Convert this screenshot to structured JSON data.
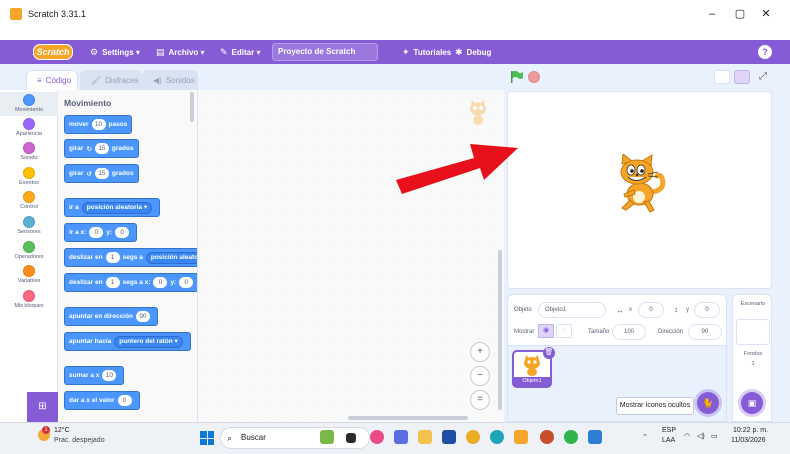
{
  "window": {
    "title": "Scratch 3.31.1",
    "minimize": "–",
    "maximize": "▢",
    "close": "✕"
  },
  "menubar": {
    "logo": "Scratch",
    "settings": "Settings",
    "file": "Archivo",
    "edit": "Editar",
    "project_title": "Proyecto de Scratch",
    "tutorials": "Tutoriales",
    "debug": "Debug",
    "help": "?"
  },
  "tabs": {
    "code": "Código",
    "costumes": "Disfraces",
    "sounds": "Sonidos"
  },
  "categories": [
    {
      "label": "Movimiento",
      "color": "#4c97ff"
    },
    {
      "label": "Apariencia",
      "color": "#9966ff"
    },
    {
      "label": "Sonido",
      "color": "#cf63cf"
    },
    {
      "label": "Eventos",
      "color": "#ffbf00"
    },
    {
      "label": "Control",
      "color": "#ffab19"
    },
    {
      "label": "Sensores",
      "color": "#5cb1d6"
    },
    {
      "label": "Operadores",
      "color": "#59c059"
    },
    {
      "label": "Variables",
      "color": "#ff8c1a"
    },
    {
      "label": "Mis bloques",
      "color": "#ff6680"
    }
  ],
  "palette": {
    "title": "Movimiento",
    "blocks": {
      "move": {
        "text": "mover",
        "value": "10",
        "suffix": "pasos"
      },
      "turn_right": {
        "text": "girar",
        "icon": "↻",
        "value": "15",
        "suffix": "grados"
      },
      "turn_left": {
        "text": "girar",
        "icon": "↺",
        "value": "15",
        "suffix": "grados"
      },
      "goto": {
        "text": "ir a",
        "dropdown": "posición aleatoria ▾"
      },
      "goto_xy": {
        "text": "ir a x:",
        "x": "0",
        "ylabel": "y:",
        "y": "0"
      },
      "glide": {
        "text": "deslizar en",
        "value": "1",
        "mid": "segs a",
        "dropdown": "posición aleatoria ▾"
      },
      "glide_xy": {
        "text": "deslizar en",
        "value": "1",
        "mid": "segs a x:",
        "x": "0",
        "ylabel": "y:",
        "y": "0"
      },
      "point_dir": {
        "text": "apuntar en dirección",
        "value": "90"
      },
      "point_towards": {
        "text": "apuntar hacia",
        "dropdown": "puntero del ratón ▾"
      },
      "change_x": {
        "text": "sumar a x",
        "value": "10"
      },
      "set_x": {
        "text": "dar a x el valor",
        "value": "0"
      }
    }
  },
  "zoom": {
    "in": "+",
    "out": "−",
    "reset": "="
  },
  "sprite_info": {
    "sprite_label": "Objeto",
    "sprite_name": "Objeto1",
    "x_label": "x",
    "x_value": "0",
    "y_label": "y",
    "y_value": "0",
    "show_label": "Mostrar",
    "size_label": "Tamaño",
    "size_value": "100",
    "direction_label": "Dirección",
    "direction_value": "90"
  },
  "sprite_list": {
    "sprite_name": "Objeto1",
    "tooltip": "Mostrar íconos ocultos"
  },
  "stage_panel": {
    "title": "Escenario",
    "backdrops_label": "Fondos",
    "backdrops_count": "1"
  },
  "taskbar": {
    "weather_temp": "12°C",
    "weather_desc": "Prac. despejado",
    "weather_badge": "1",
    "search_placeholder": "Buscar",
    "lang_1": "ESP",
    "lang_2": "LAA",
    "time": "10:22 p. m.",
    "date": "11/03/2026"
  },
  "colors": {
    "accent": "#855cd6",
    "motion": "#4c97ff",
    "control": "#ffab19",
    "arrow": "#e8101a"
  }
}
